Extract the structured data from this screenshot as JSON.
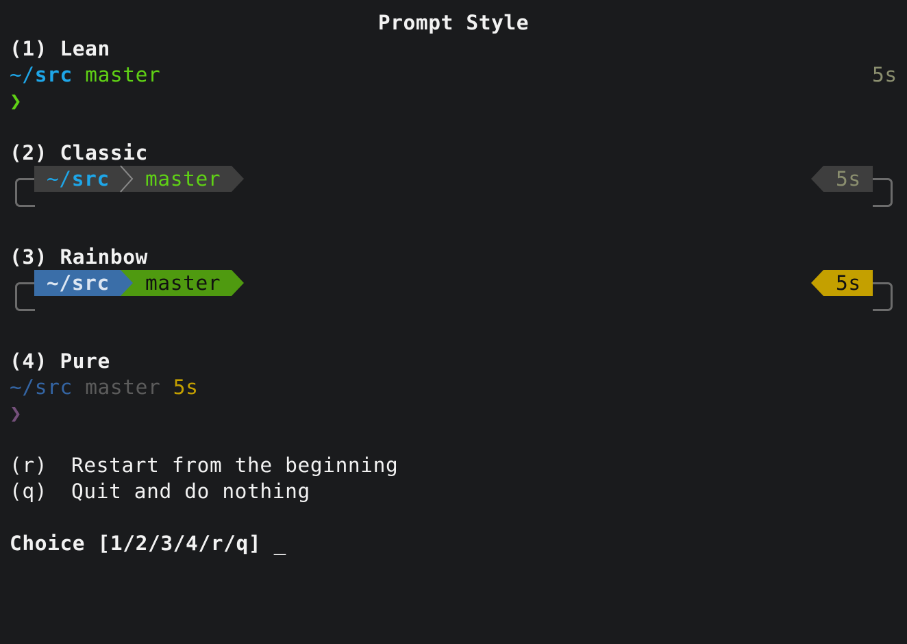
{
  "title": "Prompt Style",
  "options": [
    {
      "key_label": "(1) Lean",
      "dir_prefix": "~/",
      "dir_name": "src",
      "branch": "master",
      "duration": "5s",
      "prompt_char": "❯"
    },
    {
      "key_label": "(2) Classic",
      "dir_prefix": "~/",
      "dir_name": "src",
      "branch": "master",
      "duration": "5s"
    },
    {
      "key_label": "(3) Rainbow",
      "dir_text": "~/src",
      "branch": "master",
      "duration": "5s"
    },
    {
      "key_label": "(4) Pure",
      "dir_text": "~/src",
      "branch": "master",
      "duration": "5s",
      "prompt_char": "❯"
    }
  ],
  "actions": [
    {
      "key": "(r)",
      "label": "Restart from the beginning"
    },
    {
      "key": "(q)",
      "label": "Quit and do nothing"
    }
  ],
  "choice_prompt": "Choice [1/2/3/4/r/q]",
  "cursor": "_",
  "colors": {
    "background": "#1a1b1d",
    "text": "#f2f2f2",
    "dir_blue": "#1ea6e8",
    "branch_green": "#5fd115",
    "duration_gray": "#8b8f6f",
    "segment_gray": "#3e3e3e",
    "rainbow_blue": "#3a6ea8",
    "rainbow_green": "#4f9a10",
    "rainbow_yellow": "#c4a000",
    "pure_blue": "#3465a4",
    "pure_gray": "#5c5c5c",
    "pure_yellow": "#c4a000",
    "pure_prompt": "#75507b"
  }
}
